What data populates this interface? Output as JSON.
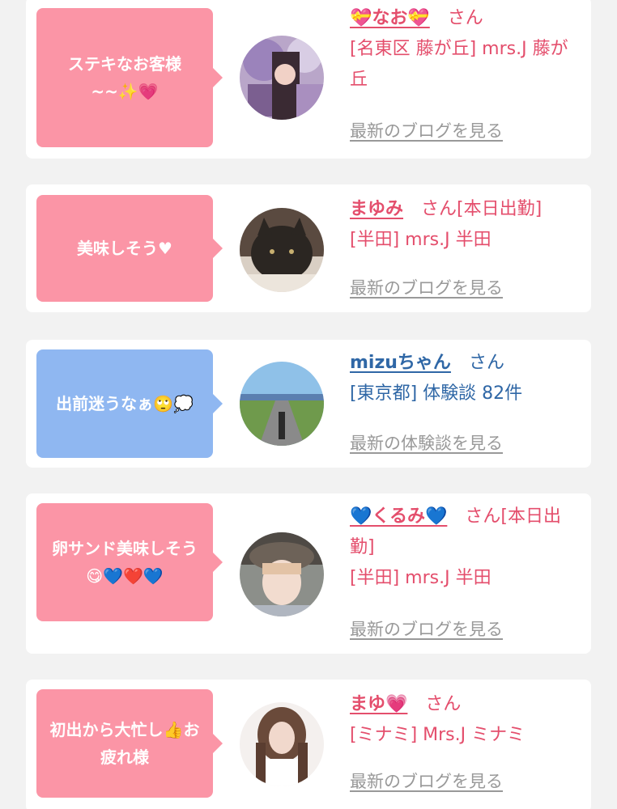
{
  "posts": [
    {
      "comment": "ステキなお客様~~✨💗",
      "name": "💝なお💝",
      "suffix": "さん",
      "detail": "[名東区 藤が丘] mrs.J 藤が丘",
      "link_label": "最新のブログを見る",
      "theme": "pink"
    },
    {
      "comment": "美味しそう♥",
      "name": "まゆみ",
      "suffix": "さん[本日出勤]",
      "detail": "[半田] mrs.J 半田",
      "link_label": "最新のブログを見る",
      "theme": "pink"
    },
    {
      "comment": "出前迷うなぁ🙄💭",
      "name": "mizuちゃん",
      "suffix": "さん",
      "detail": "[東京都] 体験談 82件",
      "link_label": "最新の体験談を見る",
      "theme": "blue"
    },
    {
      "comment": "卵サンド美味しそう😋💙❤️💙",
      "name": "💙くるみ💙",
      "suffix": "さん[本日出勤]",
      "detail": "[半田] mrs.J 半田",
      "link_label": "最新のブログを見る",
      "theme": "pink"
    },
    {
      "comment": "初出から大忙し👍お疲れ様",
      "name": "まゆ💗",
      "suffix": "さん",
      "detail": "[ミナミ] Mrs.J ミナミ",
      "link_label": "最新のブログを見る",
      "theme": "pink"
    }
  ],
  "colors": {
    "pink_bubble": "#fb95a6",
    "blue_bubble": "#8fb7f1",
    "pink_text": "#e44e6c",
    "blue_text": "#2f67a6",
    "link_gray": "#999999",
    "background": "#f2f2f2"
  }
}
